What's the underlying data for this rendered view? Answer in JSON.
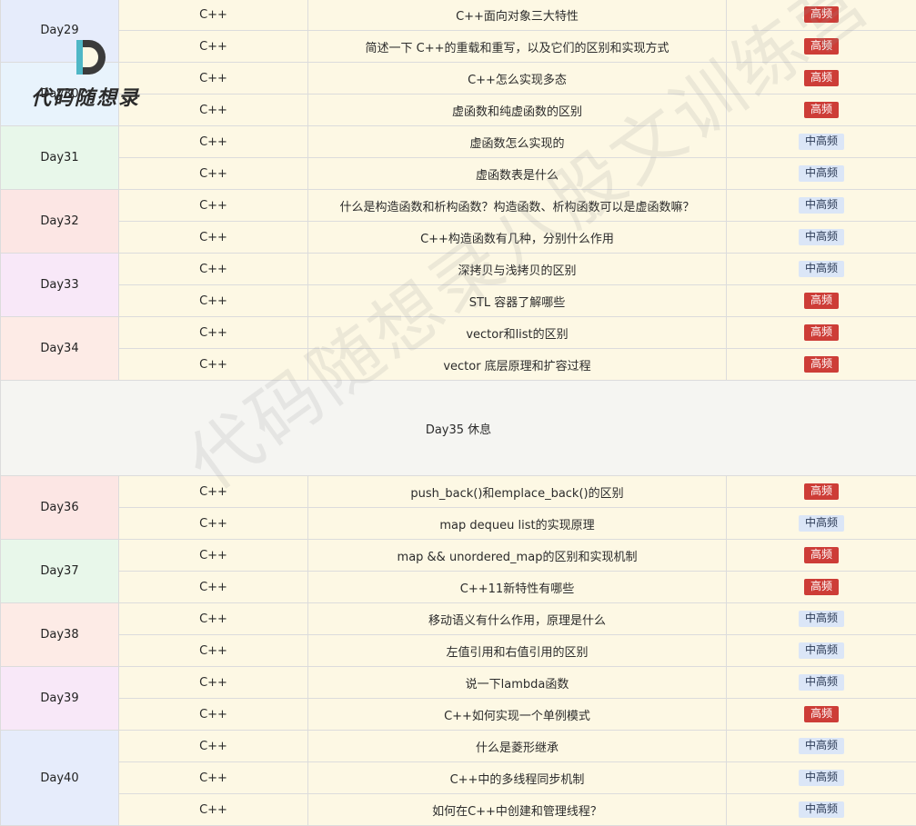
{
  "logo": {
    "text": "代码随想录"
  },
  "watermark": "代码随想录八股文训练营",
  "rest_day": "Day35 休息",
  "colors": {
    "high_badge": "#cd3d37",
    "mid_badge": "#dbe6f7",
    "row_bg": "#fdf8e4"
  },
  "groups": [
    {
      "day": "Day29",
      "color": "#e6ecfb",
      "rows": [
        {
          "category": "C++",
          "topic": "C++面向对象三大特性",
          "freq": "高频",
          "level": "high"
        },
        {
          "category": "C++",
          "topic": "简述一下 C++的重载和重写，以及它们的区别和实现方式",
          "freq": "高频",
          "level": "high"
        }
      ]
    },
    {
      "day": "Day30",
      "color": "#e8f3fc",
      "rows": [
        {
          "category": "C++",
          "topic": "C++怎么实现多态",
          "freq": "高频",
          "level": "high"
        },
        {
          "category": "C++",
          "topic": "虚函数和纯虚函数的区别",
          "freq": "高频",
          "level": "high"
        }
      ]
    },
    {
      "day": "Day31",
      "color": "#e8f7ea",
      "rows": [
        {
          "category": "C++",
          "topic": "虚函数怎么实现的",
          "freq": "中高频",
          "level": "mid"
        },
        {
          "category": "C++",
          "topic": "虚函数表是什么",
          "freq": "中高频",
          "level": "mid"
        }
      ]
    },
    {
      "day": "Day32",
      "color": "#fce6e4",
      "rows": [
        {
          "category": "C++",
          "topic": "什么是构造函数和析构函数？构造函数、析构函数可以是虚函数嘛？",
          "freq": "中高频",
          "level": "mid"
        },
        {
          "category": "C++",
          "topic": "C++构造函数有几种，分别什么作用",
          "freq": "中高频",
          "level": "mid"
        }
      ]
    },
    {
      "day": "Day33",
      "color": "#f8e8f8",
      "rows": [
        {
          "category": "C++",
          "topic": "深拷贝与浅拷贝的区别",
          "freq": "中高频",
          "level": "mid"
        },
        {
          "category": "C++",
          "topic": "STL 容器了解哪些",
          "freq": "高频",
          "level": "high"
        }
      ]
    },
    {
      "day": "Day34",
      "color": "#fdebe6",
      "rows": [
        {
          "category": "C++",
          "topic": "vector和list的区别",
          "freq": "高频",
          "level": "high"
        },
        {
          "category": "C++",
          "topic": "vector 底层原理和扩容过程",
          "freq": "高频",
          "level": "high"
        }
      ]
    },
    {
      "rest": true
    },
    {
      "day": "Day36",
      "color": "#fce6e4",
      "rows": [
        {
          "category": "C++",
          "topic": "push_back()和emplace_back()的区别",
          "freq": "高频",
          "level": "high"
        },
        {
          "category": "C++",
          "topic": "map dequeu list的实现原理",
          "freq": "中高频",
          "level": "mid"
        }
      ]
    },
    {
      "day": "Day37",
      "color": "#e8f7ea",
      "rows": [
        {
          "category": "C++",
          "topic": "map && unordered_map的区别和实现机制",
          "freq": "高频",
          "level": "high"
        },
        {
          "category": "C++",
          "topic": "C++11新特性有哪些",
          "freq": "高频",
          "level": "high"
        }
      ]
    },
    {
      "day": "Day38",
      "color": "#fdebe6",
      "rows": [
        {
          "category": "C++",
          "topic": "移动语义有什么作用，原理是什么",
          "freq": "中高频",
          "level": "mid"
        },
        {
          "category": "C++",
          "topic": "左值引用和右值引用的区别",
          "freq": "中高频",
          "level": "mid"
        }
      ]
    },
    {
      "day": "Day39",
      "color": "#f8e8f8",
      "rows": [
        {
          "category": "C++",
          "topic": "说一下lambda函数",
          "freq": "中高频",
          "level": "mid"
        },
        {
          "category": "C++",
          "topic": "C++如何实现一个单例模式",
          "freq": "高频",
          "level": "high"
        }
      ]
    },
    {
      "day": "Day40",
      "color": "#e6ecfb",
      "rows": [
        {
          "category": "C++",
          "topic": "什么是菱形继承",
          "freq": "中高频",
          "level": "mid"
        },
        {
          "category": "C++",
          "topic": "C++中的多线程同步机制",
          "freq": "中高频",
          "level": "mid"
        },
        {
          "category": "C++",
          "topic": "如何在C++中创建和管理线程？",
          "freq": "中高频",
          "level": "mid"
        }
      ]
    }
  ]
}
